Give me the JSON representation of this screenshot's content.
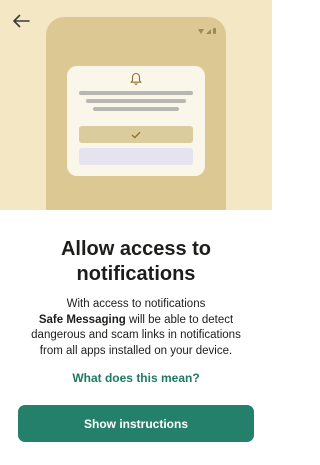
{
  "header": {
    "back_icon": "arrow-left-icon"
  },
  "illustration": {
    "colors": {
      "background": "#f3e7c4",
      "phone": "#dbc893",
      "dialog": "#faf6ea",
      "accent": "#24806a"
    }
  },
  "main": {
    "title": "Allow access to notifications",
    "description_part1": "With access to notifications",
    "description_app": "Safe Messaging",
    "description_part2": "will be able to detect dangerous and scam links in notifications from all apps installed on your device.",
    "link_label": "What does this mean?"
  },
  "footer": {
    "button_label": "Show instructions"
  }
}
